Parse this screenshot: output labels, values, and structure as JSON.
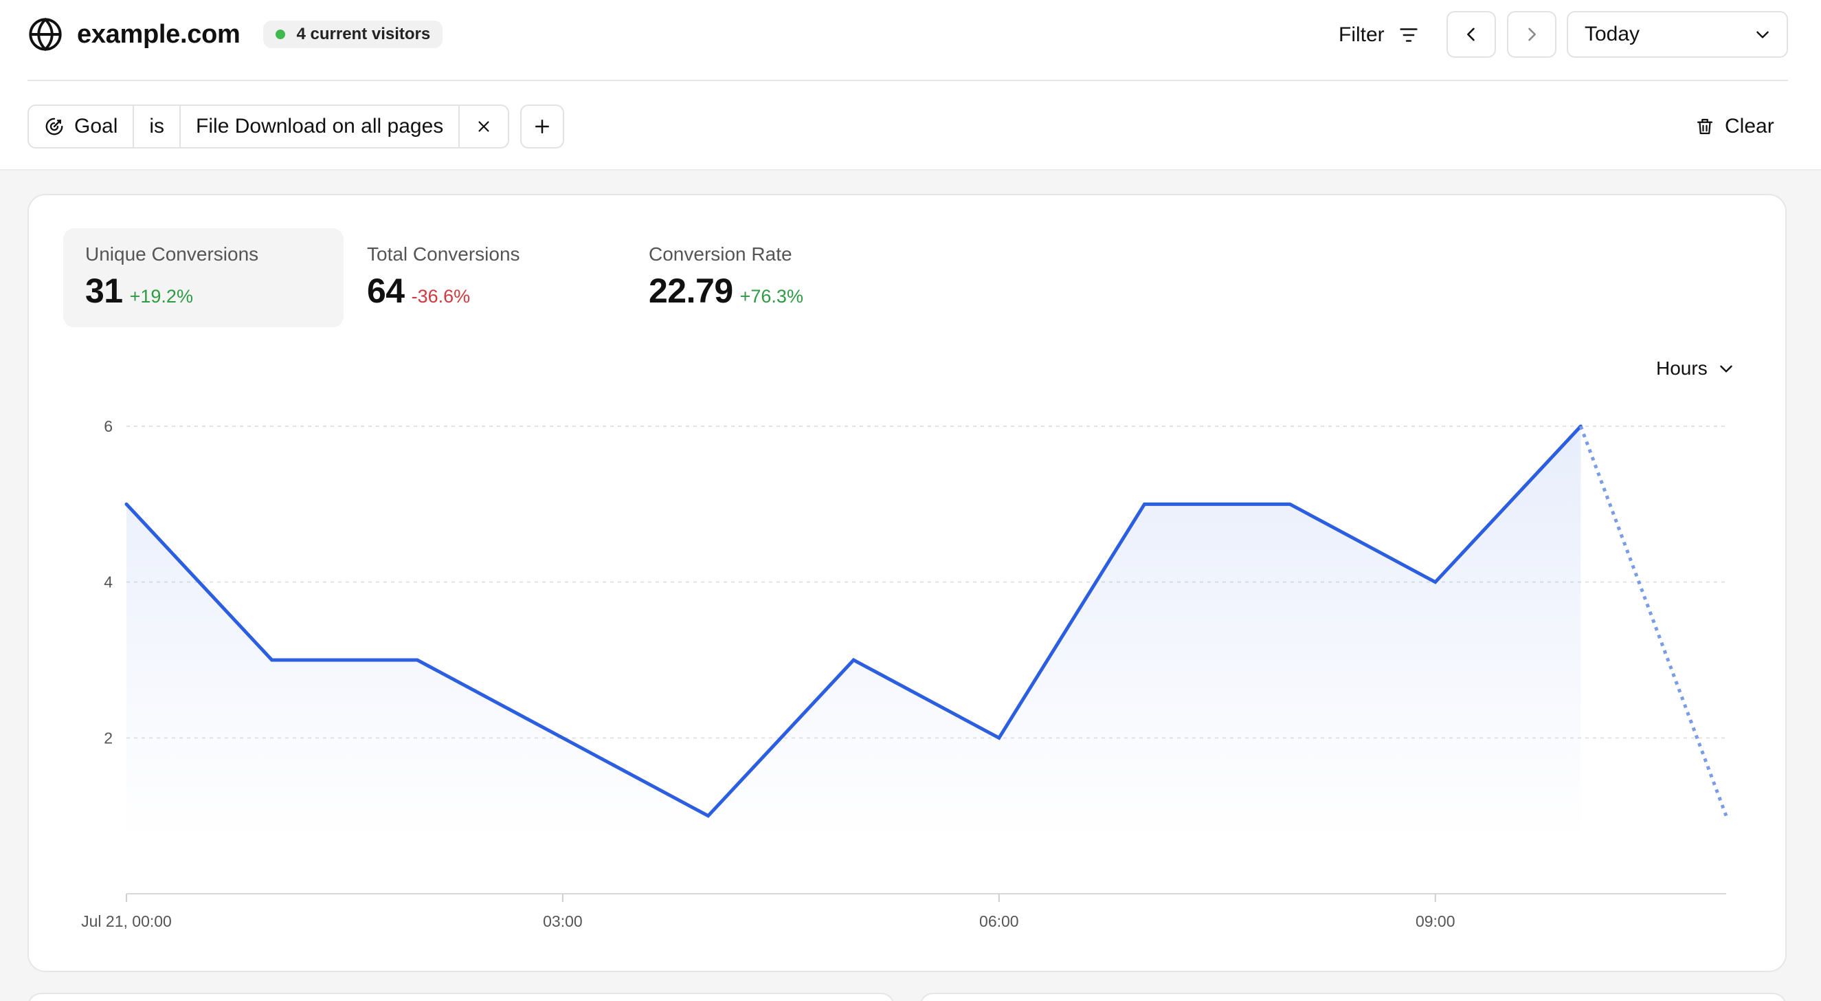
{
  "header": {
    "site_name": "example.com",
    "visitors": "4 current visitors",
    "filter_label": "Filter",
    "date_range": "Today"
  },
  "filters": {
    "dimension": "Goal",
    "operator": "is",
    "value": "File Download on all pages",
    "clear_label": "Clear"
  },
  "metrics": [
    {
      "label": "Unique Conversions",
      "value": "31",
      "change": "+19.2%",
      "trend": "positive"
    },
    {
      "label": "Total Conversions",
      "value": "64",
      "change": "-36.6%",
      "trend": "negative"
    },
    {
      "label": "Conversion Rate",
      "value": "22.79",
      "change": "+76.3%",
      "trend": "positive"
    }
  ],
  "interval": "Hours",
  "colors": {
    "line": "#2b5ee0",
    "positive": "#2f9a44",
    "negative": "#d1393d",
    "live_dot": "#3fb950"
  },
  "chart_data": {
    "type": "line",
    "x": [
      0,
      1,
      2,
      3,
      4,
      5,
      6,
      7,
      8,
      9,
      10,
      11
    ],
    "series": [
      {
        "values": [
          5,
          3,
          3,
          2,
          1,
          3,
          2,
          5,
          5,
          4,
          6,
          1
        ]
      }
    ],
    "partial_from_index": 10,
    "xticks": [
      {
        "x": 0,
        "label": "Jul 21, 00:00"
      },
      {
        "x": 3,
        "label": "03:00"
      },
      {
        "x": 6,
        "label": "06:00"
      },
      {
        "x": 9,
        "label": "09:00"
      }
    ],
    "yticks": [
      2,
      4,
      6
    ],
    "ylim": [
      0,
      6
    ],
    "xlim": [
      0,
      11
    ],
    "grid": true,
    "title": "",
    "xlabel": "",
    "ylabel": ""
  }
}
